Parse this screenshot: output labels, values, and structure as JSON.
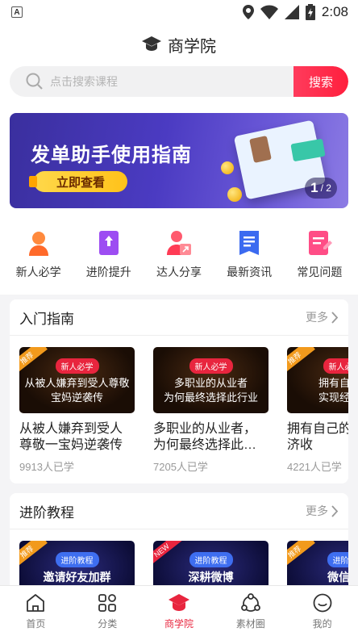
{
  "status_bar": {
    "left_icon": "A",
    "time": "2:08"
  },
  "header": {
    "title": "商学院",
    "icon": "graduation-cap-icon"
  },
  "search": {
    "placeholder": "点击搜索课程",
    "button_label": "搜索"
  },
  "banner": {
    "title": "发单助手使用指南",
    "button_label": "立即查看",
    "page_current": "1",
    "page_total": "/ 2"
  },
  "quick_nav": [
    {
      "label": "新人必学",
      "icon": "newbie-icon"
    },
    {
      "label": "进阶提升",
      "icon": "advance-book-icon"
    },
    {
      "label": "达人分享",
      "icon": "expert-share-icon"
    },
    {
      "label": "最新资讯",
      "icon": "news-icon"
    },
    {
      "label": "常见问题",
      "icon": "faq-icon"
    }
  ],
  "sections": [
    {
      "title": "入门指南",
      "more": "更多",
      "cards": [
        {
          "tag": "推荐",
          "pill": "新人必学",
          "thumb_text": "从被人嫌弃到受人尊敬\n宝妈逆袭传",
          "title": "从被人嫌弃到受人尊敬一宝妈逆袭传",
          "count": "9913人已学"
        },
        {
          "tag": "",
          "pill": "新人必学",
          "thumb_text": "多职业的从业者\n为何最终选择此行业",
          "title": "多职业的从业者，为何最终选择此…",
          "count": "7205人已学"
        },
        {
          "tag": "推荐",
          "pill": "新人必学",
          "thumb_text": "拥有自己的\n实现经济收",
          "title": "拥有自己的实现经济收",
          "count": "4221人已学"
        }
      ]
    },
    {
      "title": "进阶教程",
      "more": "更多",
      "cards": [
        {
          "tag": "推荐",
          "pill": "进阶教程",
          "thumb_text": "邀请好友加群\n实操技术",
          "title": "",
          "count": ""
        },
        {
          "tag": "NEW",
          "pill": "进阶教程",
          "thumb_text": "深耕微博\n获取更多流量",
          "title": "",
          "count": ""
        },
        {
          "tag": "推荐",
          "pill": "进阶教",
          "thumb_text": "微信/Q\n绝妙的引",
          "title": "",
          "count": ""
        }
      ]
    }
  ],
  "tabbar": [
    {
      "label": "首页",
      "icon": "home-icon",
      "active": false
    },
    {
      "label": "分类",
      "icon": "category-grid-icon",
      "active": false
    },
    {
      "label": "商学院",
      "icon": "graduation-cap-icon",
      "active": true
    },
    {
      "label": "素材圈",
      "icon": "circle-nodes-icon",
      "active": false
    },
    {
      "label": "我的",
      "icon": "smile-face-icon",
      "active": false
    }
  ],
  "colors": {
    "accent": "#e8253e",
    "banner": "#4b3bc2",
    "button_yellow": "#ffc21a"
  }
}
